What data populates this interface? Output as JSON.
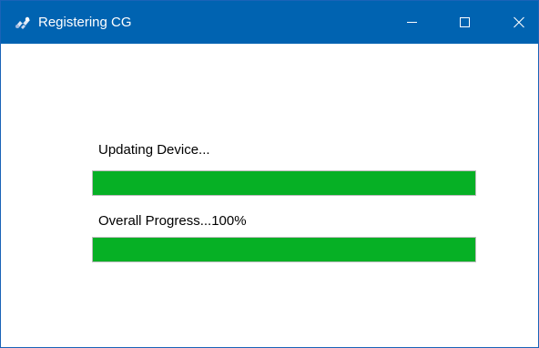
{
  "window": {
    "title": "Registering CG",
    "icon": "registration-app-icon"
  },
  "controls": {
    "minimize": "minimize-icon",
    "maximize": "maximize-icon",
    "close": "close-icon"
  },
  "progress": {
    "device": {
      "label": "Updating Device...",
      "value": 1.0
    },
    "overall": {
      "label": "Overall Progress...100%",
      "value": 1.0
    }
  },
  "colors": {
    "titlebar": "#0063b1",
    "progress_fill": "#06b025",
    "progress_track": "#e6e6e6"
  }
}
